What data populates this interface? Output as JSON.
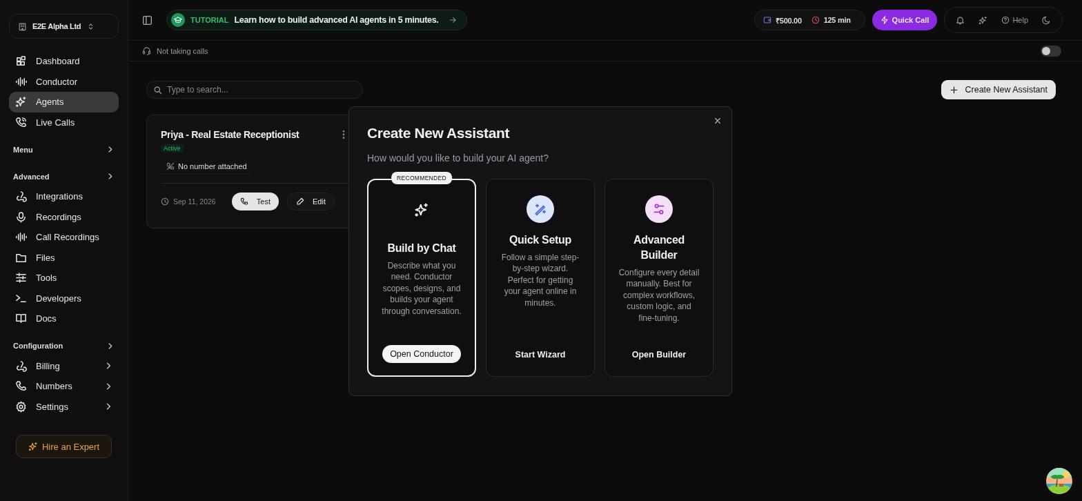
{
  "org": {
    "name": "E2E Alpha Ltd"
  },
  "sidebar": {
    "groups": [
      {
        "items": [
          {
            "label": "Dashboard",
            "selected": false,
            "submenu": false
          },
          {
            "label": "Conductor",
            "selected": false,
            "submenu": false
          },
          {
            "label": "Agents",
            "selected": true,
            "submenu": false
          },
          {
            "label": "Live Calls",
            "selected": false,
            "submenu": false
          }
        ]
      },
      {
        "title": "Menu"
      },
      {
        "title": "Advanced",
        "items": [
          {
            "label": "Integrations",
            "selected": false,
            "submenu": false
          },
          {
            "label": "Recordings",
            "selected": false,
            "submenu": false
          },
          {
            "label": "Call Recordings",
            "selected": false,
            "submenu": false
          },
          {
            "label": "Files",
            "selected": false,
            "submenu": false
          },
          {
            "label": "Tools",
            "selected": false,
            "submenu": false
          },
          {
            "label": "Developers",
            "selected": false,
            "submenu": false
          },
          {
            "label": "Docs",
            "selected": false,
            "submenu": false
          }
        ]
      },
      {
        "title": "Configuration",
        "items": [
          {
            "label": "Billing",
            "selected": false,
            "submenu": true
          },
          {
            "label": "Numbers",
            "selected": false,
            "submenu": true
          },
          {
            "label": "Settings",
            "selected": false,
            "submenu": true
          }
        ]
      }
    ],
    "cta": "Hire an Expert"
  },
  "tutorial": {
    "tag": "TUTORIAL",
    "text": "Learn how to build advanced AI agents in 5 minutes."
  },
  "balance": "₹500.00",
  "minutes": "125 min",
  "quick_call": "Quick Call",
  "help": "Help",
  "call_status": {
    "text": "Not taking calls",
    "on": false
  },
  "search": {
    "placeholder": "Type to search..."
  },
  "create_button": "Create New Assistant",
  "agents": [
    {
      "name": "Priya - Real Estate Receptionist",
      "status": "Active",
      "number": "No number attached",
      "date": "Sep 11, 2026",
      "test": "Test",
      "edit": "Edit"
    }
  ],
  "modal": {
    "title": "Create New Assistant",
    "subtitle": "How would you like to build your AI agent?",
    "options": [
      {
        "badge": "RECOMMENDED",
        "title": "Build by Chat",
        "text": "Describe what you need. Conductor scopes, designs, and builds your agent through conversation.",
        "action": "Open Conductor",
        "selected": true
      },
      {
        "title": "Quick Setup",
        "text": "Follow a simple step-by-step wizard. Perfect for getting your agent online in minutes.",
        "action": "Start Wizard",
        "selected": false
      },
      {
        "title": "Advanced Builder",
        "text": "Configure every detail manually. Best for complex workflows, custom logic, and fine-tuning.",
        "action": "Open Builder",
        "selected": false
      }
    ]
  }
}
